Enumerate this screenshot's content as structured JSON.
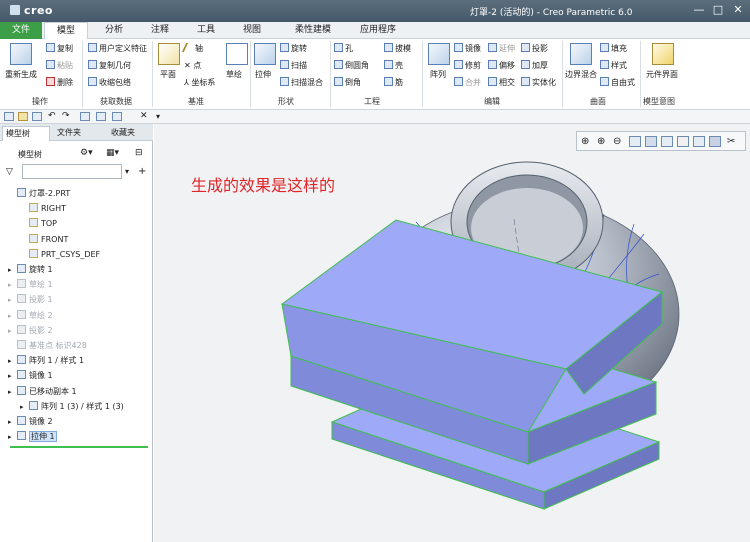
{
  "window": {
    "logo": "creo",
    "title": "灯罩-2 (活动的) - Creo Parametric 6.0",
    "controls": [
      "—",
      "□",
      "✕"
    ]
  },
  "tabs": [
    "文件",
    "模型",
    "分析",
    "注释",
    "工具",
    "视图",
    "柔性建模",
    "应用程序"
  ],
  "ribbon": {
    "operations": {
      "regen": "重新生成",
      "copy": "复制",
      "paste": "粘贴",
      "delete": "删除",
      "label": "操作"
    },
    "get_data": {
      "udf": "用户定义特征",
      "copy_geom": "复制几何",
      "shrinkwrap": "收缩包络",
      "label": "获取数据"
    },
    "datum": {
      "plane": "平面",
      "axis": "轴",
      "point": "点",
      "csys": "坐标系",
      "sketch": "草绘",
      "label": "基准"
    },
    "shapes": {
      "extrude": "拉伸",
      "revolve": "旋转",
      "sweep": "扫描",
      "swept_blend": "扫描混合",
      "label": "形状"
    },
    "engineering": {
      "hole": "孔",
      "round": "倒圆角",
      "chamfer": "倒角",
      "draft": "拔模",
      "shell": "壳",
      "rib": "筋",
      "label": "工程"
    },
    "editing": {
      "pattern": "阵列",
      "mirror": "镜像",
      "trim": "修剪",
      "merge": "合并",
      "extend": "延伸",
      "offset": "偏移",
      "intersect": "相交",
      "project": "投影",
      "thicken": "加厚",
      "solidify": "实体化",
      "label": "编辑"
    },
    "surfaces": {
      "boundary": "边界混合",
      "fill": "填充",
      "style": "样式",
      "freestyle": "自由式",
      "label": "曲面"
    },
    "model_intent": {
      "component_interface": "元件界面",
      "label": "模型意图"
    }
  },
  "panel": {
    "tabs": [
      "模型树",
      "文件夹",
      "收藏夹"
    ],
    "tree_header": "模型树",
    "filter_placeholder": "",
    "items": [
      {
        "label": "灯罩-2.PRT",
        "state": "normal"
      },
      {
        "label": "RIGHT",
        "state": "normal"
      },
      {
        "label": "TOP",
        "state": "normal"
      },
      {
        "label": "FRONT",
        "state": "normal"
      },
      {
        "label": "PRT_CSYS_DEF",
        "state": "normal"
      },
      {
        "label": "旋转 1",
        "state": "normal"
      },
      {
        "label": "草绘 1",
        "state": "suppressed"
      },
      {
        "label": "投影 1",
        "state": "suppressed"
      },
      {
        "label": "草绘 2",
        "state": "suppressed"
      },
      {
        "label": "投影 2",
        "state": "suppressed"
      },
      {
        "label": "基准点 标识428",
        "state": "suppressed"
      },
      {
        "label": "阵列 1 / 样式 1",
        "state": "normal"
      },
      {
        "label": "镜像 1",
        "state": "normal"
      },
      {
        "label": "已移动副本 1",
        "state": "normal"
      },
      {
        "label": "阵列 1 (3) / 样式 1 (3)",
        "state": "normal"
      },
      {
        "label": "镜像 2",
        "state": "normal"
      },
      {
        "label": "拉伸 1",
        "state": "selected"
      }
    ]
  },
  "viewport": {
    "caption": "生成的效果是这样的"
  },
  "colors": {
    "file_tab": "#3d9e48",
    "titlebar": "#4f6373",
    "caption": "#e0262a",
    "plane_fill": "#9ea9f8",
    "plane_edge": "#3fbf50"
  }
}
